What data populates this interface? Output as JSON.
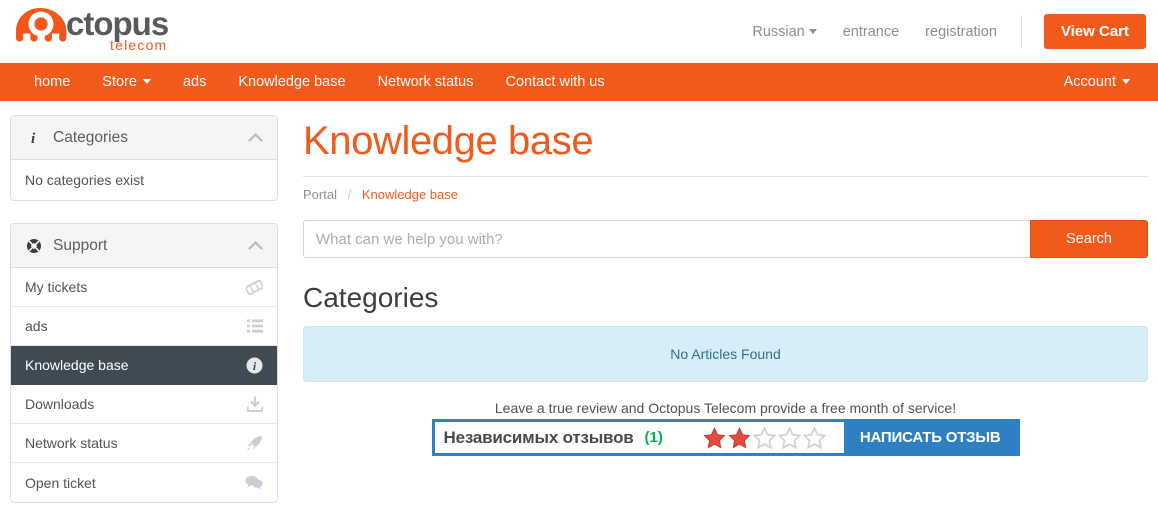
{
  "header": {
    "logo": {
      "word": "octopus",
      "tagline": "telecom",
      "accent_color": "#f4561a",
      "word_color": "#595959"
    },
    "language": "Russian",
    "entrance": "entrance",
    "registration": "registration",
    "view_cart": "View Cart"
  },
  "nav": {
    "items": [
      {
        "label": "home",
        "caret": false
      },
      {
        "label": "Store",
        "caret": true
      },
      {
        "label": "ads",
        "caret": false
      },
      {
        "label": "Knowledge base",
        "caret": false
      },
      {
        "label": "Network status",
        "caret": false
      },
      {
        "label": "Contact with us",
        "caret": false
      }
    ],
    "account": "Account",
    "bar_color": "#f15a1a"
  },
  "sidebar": {
    "categories_panel": {
      "icon": "info-italic-icon",
      "title": "Categories",
      "empty_text": "No categories exist"
    },
    "support_panel": {
      "icon": "lifebuoy-icon",
      "title": "Support",
      "items": [
        {
          "label": "My tickets",
          "icon": "ticket-icon",
          "active": false
        },
        {
          "label": "ads",
          "icon": "list-icon",
          "active": false
        },
        {
          "label": "Knowledge base",
          "icon": "info-circle-icon",
          "active": true
        },
        {
          "label": "Downloads",
          "icon": "download-icon",
          "active": false
        },
        {
          "label": "Network status",
          "icon": "rocket-icon",
          "active": false
        },
        {
          "label": "Open ticket",
          "icon": "comments-icon",
          "active": false
        }
      ]
    }
  },
  "main": {
    "page_title": "Knowledge base",
    "breadcrumb": {
      "root": "Portal",
      "separator": "/",
      "current": "Knowledge base"
    },
    "search": {
      "placeholder": "What can we help you with?",
      "value": "",
      "button": "Search"
    },
    "categories_heading": "Categories",
    "alert_text": "No Articles Found"
  },
  "review": {
    "caption": "Leave a true review and Octopus Telecom provide a free month of service!",
    "label": "Независимых отзывов",
    "count": "(1)",
    "count_color": "#00b14f",
    "rating": 2,
    "max_rating": 5,
    "star_filled_color": "#e04a3f",
    "star_empty_color": "#d8d8d8",
    "button": "НАПИСАТЬ ОТЗЫВ",
    "accent_color": "#2f80c2"
  }
}
